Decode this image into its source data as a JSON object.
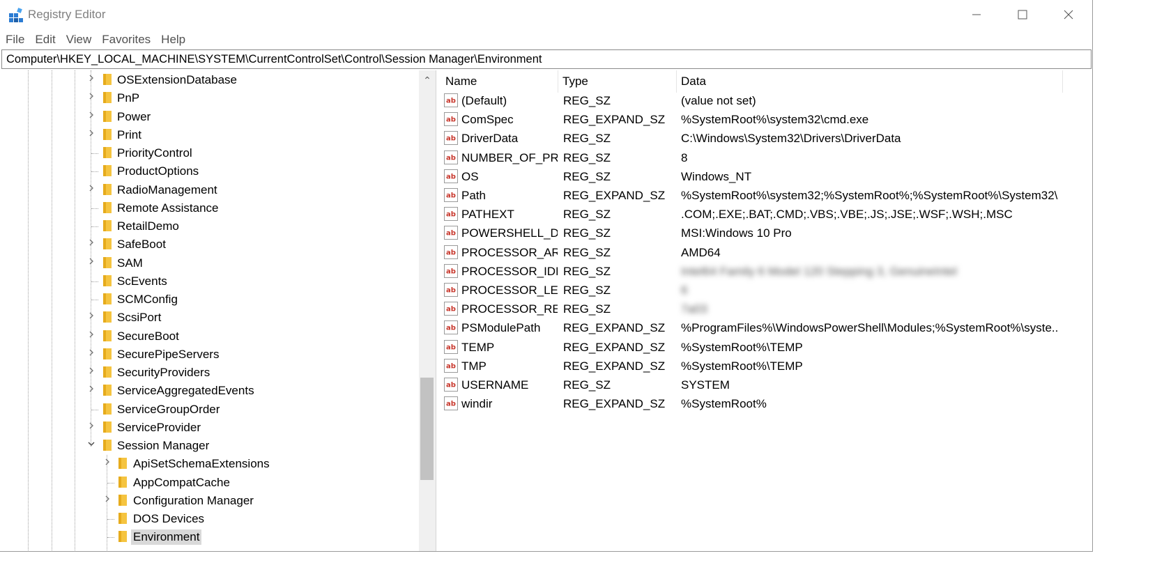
{
  "window": {
    "title": "Registry Editor",
    "controls": {
      "minimize": "minimize",
      "maximize": "maximize",
      "close": "close"
    }
  },
  "menu": [
    "File",
    "Edit",
    "View",
    "Favorites",
    "Help"
  ],
  "address": "Computer\\HKEY_LOCAL_MACHINE\\SYSTEM\\CurrentControlSet\\Control\\Session Manager\\Environment",
  "tree": {
    "items": [
      {
        "label": "OSExtensionDatabase",
        "expander": "collapsed",
        "level": 0
      },
      {
        "label": "PnP",
        "expander": "collapsed",
        "level": 0
      },
      {
        "label": "Power",
        "expander": "collapsed",
        "level": 0
      },
      {
        "label": "Print",
        "expander": "collapsed",
        "level": 0
      },
      {
        "label": "PriorityControl",
        "expander": "none",
        "level": 0
      },
      {
        "label": "ProductOptions",
        "expander": "none",
        "level": 0
      },
      {
        "label": "RadioManagement",
        "expander": "collapsed",
        "level": 0
      },
      {
        "label": "Remote Assistance",
        "expander": "none",
        "level": 0
      },
      {
        "label": "RetailDemo",
        "expander": "none",
        "level": 0
      },
      {
        "label": "SafeBoot",
        "expander": "collapsed",
        "level": 0
      },
      {
        "label": "SAM",
        "expander": "collapsed",
        "level": 0
      },
      {
        "label": "ScEvents",
        "expander": "none",
        "level": 0
      },
      {
        "label": "SCMConfig",
        "expander": "none",
        "level": 0
      },
      {
        "label": "ScsiPort",
        "expander": "collapsed",
        "level": 0
      },
      {
        "label": "SecureBoot",
        "expander": "collapsed",
        "level": 0
      },
      {
        "label": "SecurePipeServers",
        "expander": "collapsed",
        "level": 0
      },
      {
        "label": "SecurityProviders",
        "expander": "collapsed",
        "level": 0
      },
      {
        "label": "ServiceAggregatedEvents",
        "expander": "collapsed",
        "level": 0
      },
      {
        "label": "ServiceGroupOrder",
        "expander": "none",
        "level": 0
      },
      {
        "label": "ServiceProvider",
        "expander": "collapsed",
        "level": 0
      },
      {
        "label": "Session Manager",
        "expander": "expanded",
        "level": 0
      },
      {
        "label": "ApiSetSchemaExtensions",
        "expander": "collapsed",
        "level": 1
      },
      {
        "label": "AppCompatCache",
        "expander": "none",
        "level": 1
      },
      {
        "label": "Configuration Manager",
        "expander": "collapsed",
        "level": 1
      },
      {
        "label": "DOS Devices",
        "expander": "none",
        "level": 1
      },
      {
        "label": "Environment",
        "expander": "none",
        "level": 1,
        "selected": true
      }
    ]
  },
  "list": {
    "headers": {
      "name": "Name",
      "type": "Type",
      "data": "Data"
    },
    "rows": [
      {
        "name": "(Default)",
        "type": "REG_SZ",
        "data": "(value not set)"
      },
      {
        "name": "ComSpec",
        "type": "REG_EXPAND_SZ",
        "data": "%SystemRoot%\\system32\\cmd.exe"
      },
      {
        "name": "DriverData",
        "type": "REG_SZ",
        "data": "C:\\Windows\\System32\\Drivers\\DriverData"
      },
      {
        "name": "NUMBER_OF_PR...",
        "type": "REG_SZ",
        "data": "8"
      },
      {
        "name": "OS",
        "type": "REG_SZ",
        "data": "Windows_NT"
      },
      {
        "name": "Path",
        "type": "REG_EXPAND_SZ",
        "data": "%SystemRoot%\\system32;%SystemRoot%;%SystemRoot%\\System32\\..."
      },
      {
        "name": "PATHEXT",
        "type": "REG_SZ",
        "data": ".COM;.EXE;.BAT;.CMD;.VBS;.VBE;.JS;.JSE;.WSF;.WSH;.MSC"
      },
      {
        "name": "POWERSHELL_DI...",
        "type": "REG_SZ",
        "data": "MSI:Windows 10 Pro"
      },
      {
        "name": "PROCESSOR_AR...",
        "type": "REG_SZ",
        "data": "AMD64"
      },
      {
        "name": "PROCESSOR_IDE...",
        "type": "REG_SZ",
        "data": "Intel64 Family 6 Model 120 Stepping 3, GenuineIntel",
        "blurred": true
      },
      {
        "name": "PROCESSOR_LEV...",
        "type": "REG_SZ",
        "data": "6",
        "blurred": true
      },
      {
        "name": "PROCESSOR_RE...",
        "type": "REG_SZ",
        "data": "7a03",
        "blurred": true
      },
      {
        "name": "PSModulePath",
        "type": "REG_EXPAND_SZ",
        "data": "%ProgramFiles%\\WindowsPowerShell\\Modules;%SystemRoot%\\syste..."
      },
      {
        "name": "TEMP",
        "type": "REG_EXPAND_SZ",
        "data": "%SystemRoot%\\TEMP"
      },
      {
        "name": "TMP",
        "type": "REG_EXPAND_SZ",
        "data": "%SystemRoot%\\TEMP"
      },
      {
        "name": "USERNAME",
        "type": "REG_SZ",
        "data": "SYSTEM"
      },
      {
        "name": "windir",
        "type": "REG_EXPAND_SZ",
        "data": "%SystemRoot%"
      }
    ]
  },
  "colors": {
    "folder": "#f5c440",
    "value_icon_red": "#c8362b",
    "selection": "#d9d9d9"
  }
}
